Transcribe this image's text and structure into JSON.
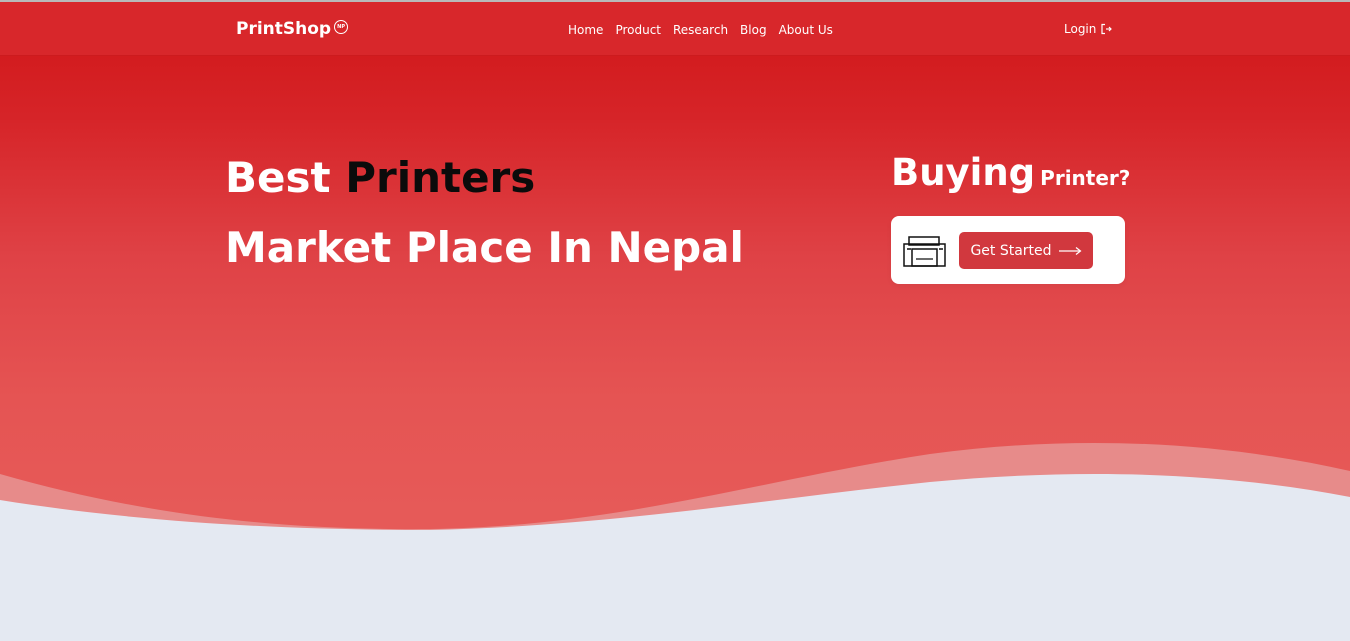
{
  "nav": {
    "brand": "PrintShop",
    "brand_badge": "NP",
    "links": [
      {
        "label": "Home"
      },
      {
        "label": "Product"
      },
      {
        "label": "Research"
      },
      {
        "label": "Blog"
      },
      {
        "label": "About Us"
      }
    ],
    "login": "Login",
    "login_icon": "logout-arrow-icon"
  },
  "hero": {
    "line1_a": "Best",
    "line1_b": "Printers",
    "line2": "Market Place In Nepal",
    "buying_big": "Buying",
    "buying_small": "Printer?",
    "cta_label": "Get Started",
    "cta_arrow_icon": "right-arrow-icon",
    "cta_printer_icon": "printer-icon"
  },
  "colors": {
    "nav_bg": "#d8272b",
    "hero_top": "#d01517",
    "hero_bottom": "#e75d5b",
    "wave_light": "#e78b8a",
    "content_bg": "#e4e9f2",
    "cta_button": "#d1383e",
    "accent_text": "#0b0b0b",
    "white": "#ffffff"
  }
}
